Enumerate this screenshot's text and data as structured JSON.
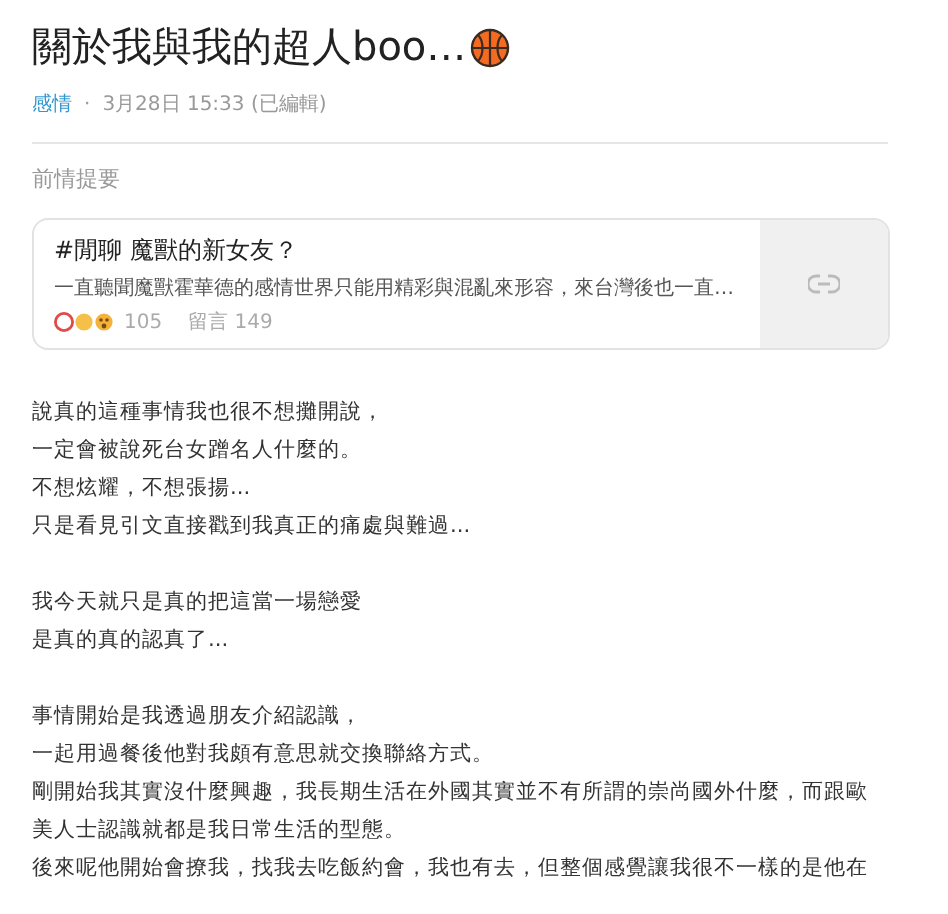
{
  "title": "關於我與我的超人boo…",
  "meta": {
    "category": "感情",
    "separator": "·",
    "time": "3月28日 15:33 (已編輯)"
  },
  "section_label": "前情提要",
  "link_card": {
    "title": "#閒聊 魔獸的新女友？",
    "excerpt": "一直聽聞魔獸霍華德的感情世界只能用精彩與混亂來形容，來台灣後也一直…",
    "likes": "105",
    "comments": "留言 149"
  },
  "paragraphs": [
    [
      "說真的這種事情我也很不想攤開說，",
      "一定會被說死台女蹭名人什麼的。",
      "不想炫耀，不想張揚...",
      "只是看見引文直接戳到我真正的痛處與難過..."
    ],
    [
      "我今天就只是真的把這當一場戀愛",
      "是真的真的認真了..."
    ],
    [
      "事情開始是我透過朋友介紹認識，",
      "一起用過餐後他對我頗有意思就交換聯絡方式。",
      "剛開始我其實沒什麼興趣，我長期生活在外國其實並不有所謂的崇尚國外什麼，而跟歐",
      "美人士認識就都是我日常生活的型態。",
      "後來呢他開始會撩我，找我去吃飯約會，我也有去，但整個感覺讓我很不一樣的是他在"
    ]
  ]
}
